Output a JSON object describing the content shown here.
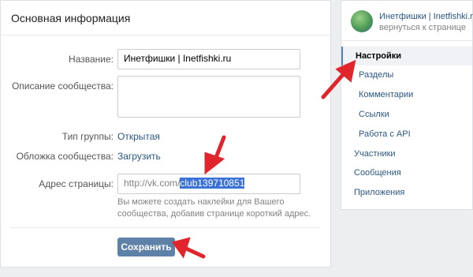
{
  "main": {
    "title": "Основная информация",
    "fields": {
      "name_label": "Название:",
      "name_value": "Инетфишки | Inetfishki.ru",
      "description_label": "Описание сообщества:",
      "group_type_label": "Тип группы:",
      "group_type_value": "Открытая",
      "cover_label": "Обложка сообщества:",
      "cover_action": "Загрузить",
      "address_label": "Адрес страницы:",
      "address_prefix": "http://vk.com/",
      "address_value": "club139710851",
      "address_hint": "Вы можете создать наклейки для Вашего сообщества, добавив странице короткий адрес."
    },
    "save_label": "Сохранить"
  },
  "sidebar": {
    "group_name": "Инетфишки | Inetfishki.ru",
    "back_link": "вернуться к странице",
    "items": [
      {
        "label": "Настройки"
      },
      {
        "label": "Разделы"
      },
      {
        "label": "Комментарии"
      },
      {
        "label": "Ссылки"
      },
      {
        "label": "Работа с API"
      },
      {
        "label": "Участники"
      },
      {
        "label": "Сообщения"
      },
      {
        "label": "Приложения"
      }
    ]
  },
  "colors": {
    "accent": "#5e81a8",
    "link": "#2a5885",
    "annotation_arrow": "#e0262c",
    "selection": "#3a72d8"
  }
}
